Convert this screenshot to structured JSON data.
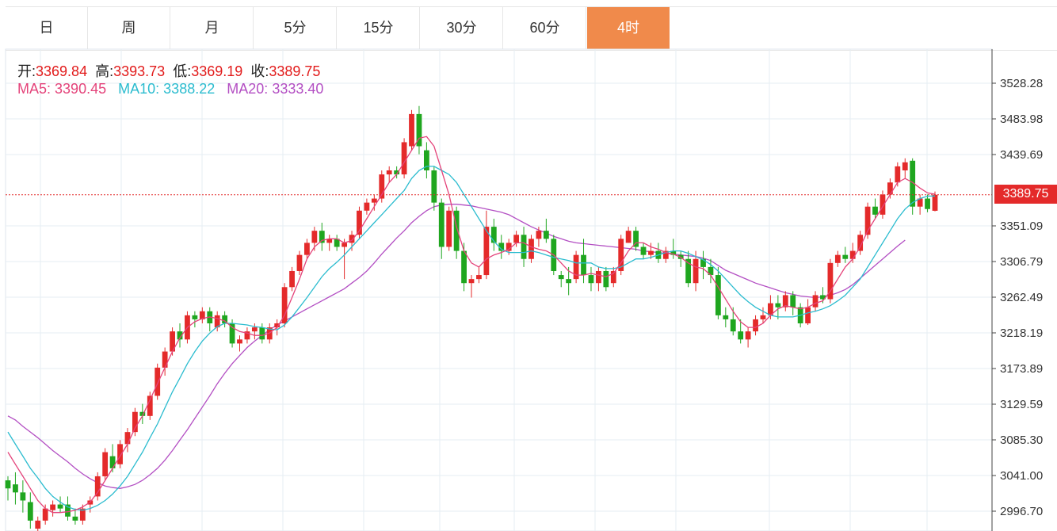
{
  "tabs": [
    {
      "label": "日"
    },
    {
      "label": "周"
    },
    {
      "label": "月"
    },
    {
      "label": "5分"
    },
    {
      "label": "15分"
    },
    {
      "label": "30分"
    },
    {
      "label": "60分"
    },
    {
      "label": "4时",
      "active": true
    }
  ],
  "ohlc": {
    "open_label": "开:",
    "open": "3369.84",
    "high_label": "高:",
    "high": "3393.73",
    "low_label": "低:",
    "low": "3369.19",
    "close_label": "收:",
    "close": "3389.75"
  },
  "ma": {
    "ma5_label": "MA5:",
    "ma5": "3390.45",
    "ma10_label": "MA10:",
    "ma10": "3388.22",
    "ma20_label": "MA20:",
    "ma20": "3333.40"
  },
  "last_price": "3389.75",
  "colors": {
    "up": "#e42a2a",
    "down": "#1fa61f",
    "ma5": "#e4437a",
    "ma10": "#2bbccf",
    "ma20": "#b34fc3",
    "active_tab": "#f08a4b",
    "grid": "#e6edf3"
  },
  "chart_data": {
    "type": "candlestick",
    "y_ticks": [
      3528.28,
      3483.98,
      3439.69,
      3351.09,
      3306.79,
      3262.49,
      3218.19,
      3173.89,
      3129.59,
      3085.3,
      3041.0,
      2996.7
    ],
    "ylim": [
      2980,
      3560
    ],
    "grid": true,
    "last_price": 3389.75,
    "ohlc": [
      [
        3035,
        3040,
        3010,
        3025
      ],
      [
        3030,
        3045,
        3005,
        3020
      ],
      [
        3020,
        3035,
        2995,
        3010
      ],
      [
        3008,
        3020,
        2975,
        2985
      ],
      [
        2975,
        2990,
        2970,
        2985
      ],
      [
        2985,
        3005,
        2980,
        3000
      ],
      [
        2998,
        3010,
        2990,
        3005
      ],
      [
        3005,
        3015,
        2995,
        3000
      ],
      [
        3005,
        3015,
        2985,
        2990
      ],
      [
        2990,
        3000,
        2980,
        2985
      ],
      [
        2985,
        3005,
        2980,
        3000
      ],
      [
        3005,
        3015,
        2995,
        3010
      ],
      [
        3015,
        3045,
        3010,
        3040
      ],
      [
        3040,
        3075,
        3035,
        3070
      ],
      [
        3065,
        3080,
        3045,
        3050
      ],
      [
        3055,
        3085,
        3050,
        3080
      ],
      [
        3080,
        3100,
        3070,
        3095
      ],
      [
        3095,
        3125,
        3090,
        3120
      ],
      [
        3120,
        3130,
        3105,
        3115
      ],
      [
        3115,
        3145,
        3110,
        3140
      ],
      [
        3140,
        3180,
        3135,
        3175
      ],
      [
        3175,
        3200,
        3165,
        3195
      ],
      [
        3195,
        3225,
        3190,
        3220
      ],
      [
        3220,
        3230,
        3200,
        3210
      ],
      [
        3210,
        3245,
        3205,
        3240
      ],
      [
        3240,
        3245,
        3225,
        3235
      ],
      [
        3235,
        3250,
        3230,
        3245
      ],
      [
        3245,
        3250,
        3220,
        3230
      ],
      [
        3225,
        3245,
        3220,
        3240
      ],
      [
        3240,
        3245,
        3225,
        3230
      ],
      [
        3230,
        3235,
        3200,
        3205
      ],
      [
        3205,
        3215,
        3195,
        3210
      ],
      [
        3210,
        3225,
        3205,
        3220
      ],
      [
        3220,
        3230,
        3210,
        3225
      ],
      [
        3225,
        3230,
        3205,
        3210
      ],
      [
        3210,
        3230,
        3205,
        3225
      ],
      [
        3225,
        3235,
        3215,
        3230
      ],
      [
        3230,
        3280,
        3225,
        3275
      ],
      [
        3275,
        3300,
        3270,
        3295
      ],
      [
        3295,
        3320,
        3290,
        3315
      ],
      [
        3315,
        3335,
        3310,
        3330
      ],
      [
        3330,
        3350,
        3320,
        3345
      ],
      [
        3345,
        3355,
        3320,
        3330
      ],
      [
        3330,
        3340,
        3320,
        3335
      ],
      [
        3335,
        3340,
        3320,
        3325
      ],
      [
        3325,
        3335,
        3285,
        3330
      ],
      [
        3330,
        3345,
        3320,
        3340
      ],
      [
        3340,
        3375,
        3335,
        3370
      ],
      [
        3370,
        3385,
        3365,
        3380
      ],
      [
        3380,
        3390,
        3370,
        3385
      ],
      [
        3385,
        3420,
        3380,
        3415
      ],
      [
        3415,
        3425,
        3405,
        3420
      ],
      [
        3420,
        3425,
        3410,
        3415
      ],
      [
        3415,
        3460,
        3410,
        3455
      ],
      [
        3450,
        3495,
        3445,
        3490
      ],
      [
        3490,
        3500,
        3440,
        3450
      ],
      [
        3445,
        3455,
        3410,
        3420
      ],
      [
        3420,
        3425,
        3370,
        3380
      ],
      [
        3380,
        3385,
        3310,
        3325
      ],
      [
        3325,
        3375,
        3320,
        3370
      ],
      [
        3370,
        3375,
        3310,
        3320
      ],
      [
        3320,
        3330,
        3270,
        3280
      ],
      [
        3280,
        3290,
        3262,
        3285
      ],
      [
        3285,
        3300,
        3280,
        3290
      ],
      [
        3290,
        3370,
        3285,
        3350
      ],
      [
        3350,
        3360,
        3320,
        3330
      ],
      [
        3330,
        3340,
        3310,
        3320
      ],
      [
        3320,
        3335,
        3315,
        3330
      ],
      [
        3330,
        3345,
        3325,
        3340
      ],
      [
        3340,
        3350,
        3300,
        3310
      ],
      [
        3310,
        3340,
        3305,
        3335
      ],
      [
        3335,
        3350,
        3325,
        3345
      ],
      [
        3345,
        3360,
        3330,
        3335
      ],
      [
        3335,
        3340,
        3290,
        3295
      ],
      [
        3290,
        3295,
        3275,
        3285
      ],
      [
        3285,
        3300,
        3265,
        3280
      ],
      [
        3285,
        3320,
        3280,
        3315
      ],
      [
        3315,
        3335,
        3280,
        3290
      ],
      [
        3290,
        3300,
        3270,
        3280
      ],
      [
        3280,
        3300,
        3270,
        3295
      ],
      [
        3295,
        3300,
        3270,
        3275
      ],
      [
        3280,
        3300,
        3275,
        3295
      ],
      [
        3295,
        3340,
        3290,
        3335
      ],
      [
        3330,
        3350,
        3330,
        3345
      ],
      [
        3345,
        3350,
        3320,
        3325
      ],
      [
        3325,
        3330,
        3310,
        3315
      ],
      [
        3315,
        3330,
        3310,
        3320
      ],
      [
        3320,
        3330,
        3305,
        3310
      ],
      [
        3310,
        3325,
        3305,
        3320
      ],
      [
        3320,
        3335,
        3310,
        3315
      ],
      [
        3315,
        3320,
        3300,
        3310
      ],
      [
        3310,
        3320,
        3275,
        3280
      ],
      [
        3280,
        3320,
        3270,
        3310
      ],
      [
        3310,
        3320,
        3285,
        3300
      ],
      [
        3300,
        3310,
        3280,
        3290
      ],
      [
        3290,
        3300,
        3235,
        3240
      ],
      [
        3240,
        3250,
        3225,
        3235
      ],
      [
        3235,
        3250,
        3215,
        3220
      ],
      [
        3220,
        3235,
        3205,
        3210
      ],
      [
        3210,
        3225,
        3200,
        3220
      ],
      [
        3220,
        3240,
        3215,
        3235
      ],
      [
        3235,
        3250,
        3230,
        3240
      ],
      [
        3240,
        3265,
        3235,
        3255
      ],
      [
        3255,
        3265,
        3235,
        3250
      ],
      [
        3250,
        3270,
        3245,
        3265
      ],
      [
        3265,
        3270,
        3240,
        3250
      ],
      [
        3250,
        3255,
        3225,
        3230
      ],
      [
        3230,
        3260,
        3228,
        3250
      ],
      [
        3250,
        3270,
        3245,
        3265
      ],
      [
        3265,
        3275,
        3255,
        3260
      ],
      [
        3260,
        3310,
        3255,
        3305
      ],
      [
        3305,
        3320,
        3300,
        3315
      ],
      [
        3315,
        3325,
        3305,
        3310
      ],
      [
        3310,
        3330,
        3305,
        3320
      ],
      [
        3320,
        3345,
        3315,
        3340
      ],
      [
        3340,
        3380,
        3335,
        3375
      ],
      [
        3375,
        3385,
        3360,
        3365
      ],
      [
        3365,
        3395,
        3360,
        3390
      ],
      [
        3390,
        3410,
        3385,
        3405
      ],
      [
        3405,
        3430,
        3400,
        3425
      ],
      [
        3420,
        3435,
        3410,
        3430
      ],
      [
        3432,
        3435,
        3365,
        3375
      ],
      [
        3375,
        3390,
        3365,
        3385
      ],
      [
        3385,
        3390,
        3368,
        3372
      ],
      [
        3369.84,
        3393.73,
        3369.19,
        3389.75
      ]
    ],
    "ma5": [
      3070,
      3055,
      3040,
      3025,
      3010,
      3000,
      2995,
      2995,
      2996,
      2998,
      3002,
      3008,
      3020,
      3035,
      3050,
      3065,
      3080,
      3100,
      3115,
      3135,
      3155,
      3175,
      3195,
      3212,
      3225,
      3232,
      3236,
      3238,
      3236,
      3233,
      3225,
      3220,
      3218,
      3215,
      3215,
      3218,
      3225,
      3240,
      3262,
      3285,
      3310,
      3325,
      3333,
      3335,
      3335,
      3330,
      3333,
      3345,
      3360,
      3375,
      3390,
      3405,
      3415,
      3430,
      3445,
      3460,
      3462,
      3450,
      3420,
      3390,
      3350,
      3320,
      3305,
      3300,
      3310,
      3315,
      3318,
      3322,
      3330,
      3330,
      3325,
      3322,
      3320,
      3315,
      3305,
      3295,
      3290,
      3290,
      3292,
      3290,
      3288,
      3292,
      3305,
      3320,
      3330,
      3330,
      3325,
      3322,
      3318,
      3316,
      3312,
      3305,
      3300,
      3298,
      3290,
      3275,
      3260,
      3245,
      3232,
      3225,
      3225,
      3230,
      3240,
      3248,
      3252,
      3250,
      3248,
      3250,
      3255,
      3258,
      3270,
      3285,
      3300,
      3310,
      3325,
      3345,
      3360,
      3375,
      3390,
      3405,
      3410,
      3405,
      3398,
      3392,
      3390.45
    ],
    "ma10": [
      3095,
      3080,
      3065,
      3050,
      3038,
      3025,
      3015,
      3008,
      3002,
      2999,
      2998,
      3000,
      3004,
      3010,
      3018,
      3028,
      3040,
      3055,
      3070,
      3088,
      3105,
      3125,
      3145,
      3162,
      3180,
      3195,
      3208,
      3218,
      3226,
      3230,
      3230,
      3229,
      3228,
      3226,
      3225,
      3223,
      3222,
      3228,
      3238,
      3250,
      3262,
      3275,
      3288,
      3298,
      3306,
      3315,
      3325,
      3335,
      3345,
      3355,
      3365,
      3375,
      3385,
      3395,
      3410,
      3420,
      3425,
      3425,
      3420,
      3415,
      3405,
      3390,
      3375,
      3360,
      3345,
      3332,
      3322,
      3318,
      3318,
      3318,
      3320,
      3318,
      3315,
      3312,
      3310,
      3308,
      3305,
      3305,
      3305,
      3300,
      3298,
      3298,
      3300,
      3305,
      3310,
      3310,
      3312,
      3315,
      3318,
      3320,
      3320,
      3317,
      3313,
      3309,
      3303,
      3295,
      3285,
      3275,
      3265,
      3257,
      3250,
      3245,
      3240,
      3238,
      3238,
      3238,
      3240,
      3243,
      3245,
      3248,
      3252,
      3258,
      3265,
      3275,
      3285,
      3300,
      3315,
      3330,
      3345,
      3360,
      3372,
      3380,
      3385,
      3388,
      3388.22
    ],
    "ma20": [
      3115,
      3110,
      3102,
      3095,
      3088,
      3080,
      3072,
      3065,
      3058,
      3050,
      3043,
      3037,
      3032,
      3028,
      3026,
      3025,
      3027,
      3030,
      3035,
      3042,
      3050,
      3060,
      3072,
      3085,
      3098,
      3112,
      3126,
      3140,
      3155,
      3168,
      3180,
      3190,
      3200,
      3208,
      3215,
      3222,
      3228,
      3233,
      3238,
      3243,
      3248,
      3253,
      3258,
      3263,
      3268,
      3273,
      3280,
      3287,
      3295,
      3305,
      3316,
      3326,
      3336,
      3345,
      3355,
      3363,
      3370,
      3375,
      3377,
      3378,
      3378,
      3377,
      3376,
      3374,
      3372,
      3370,
      3368,
      3365,
      3360,
      3355,
      3350,
      3346,
      3342,
      3338,
      3335,
      3332,
      3330,
      3329,
      3328,
      3327,
      3326,
      3325,
      3324,
      3323,
      3322,
      3320,
      3319,
      3318,
      3317,
      3316,
      3315,
      3314,
      3313,
      3311,
      3308,
      3302,
      3296,
      3292,
      3288,
      3284,
      3280,
      3277,
      3274,
      3271,
      3268,
      3266,
      3264,
      3263,
      3262,
      3263,
      3265,
      3268,
      3272,
      3278,
      3286,
      3294,
      3302,
      3310,
      3318,
      3326,
      3333.4
    ]
  }
}
